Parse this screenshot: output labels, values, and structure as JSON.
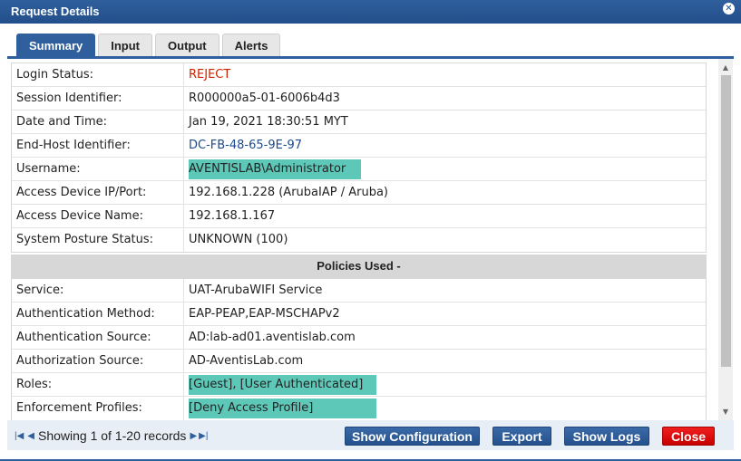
{
  "dialog": {
    "title": "Request Details",
    "close_icon": "close-icon"
  },
  "tabs": [
    {
      "label": "Summary",
      "active": true
    },
    {
      "label": "Input",
      "active": false
    },
    {
      "label": "Output",
      "active": false
    },
    {
      "label": "Alerts",
      "active": false
    }
  ],
  "summary": {
    "rows": [
      {
        "label": "Login Status:",
        "value": "REJECT"
      },
      {
        "label": "Session Identifier:",
        "value": "R000000a5-01-6006b4d3"
      },
      {
        "label": "Date and Time:",
        "value": "Jan 19, 2021 18:30:51 MYT"
      },
      {
        "label": "End-Host Identifier:",
        "value": "DC-FB-48-65-9E-97"
      },
      {
        "label": "Username:",
        "value": "AVENTISLAB\\Administrator"
      },
      {
        "label": "Access Device IP/Port:",
        "value": "192.168.1.228 (ArubaIAP / Aruba)"
      },
      {
        "label": "Access Device Name:",
        "value": "192.168.1.167"
      },
      {
        "label": "System Posture Status:",
        "value": "UNKNOWN (100)"
      }
    ]
  },
  "policies": {
    "heading": "Policies Used -",
    "rows": [
      {
        "label": "Service:",
        "value": "UAT-ArubaWIFI Service"
      },
      {
        "label": "Authentication Method:",
        "value": "EAP-PEAP,EAP-MSCHAPv2"
      },
      {
        "label": "Authentication Source:",
        "value": "AD:lab-ad01.aventislab.com"
      },
      {
        "label": "Authorization Source:",
        "value": "AD-AventisLab.com"
      },
      {
        "label": "Roles:",
        "value": "[Guest], [User Authenticated]"
      },
      {
        "label": "Enforcement Profiles:",
        "value": "[Deny Access Profile]"
      }
    ]
  },
  "footer": {
    "pager_text": "Showing 1 of 1-20 records",
    "buttons": {
      "show_configuration": "Show Configuration",
      "export": "Export",
      "show_logs": "Show Logs",
      "close": "Close"
    }
  },
  "colors": {
    "accent": "#2f5f9c",
    "reject": "#cc2200",
    "highlight": "#5ec8b8",
    "close_button": "#e00000"
  }
}
